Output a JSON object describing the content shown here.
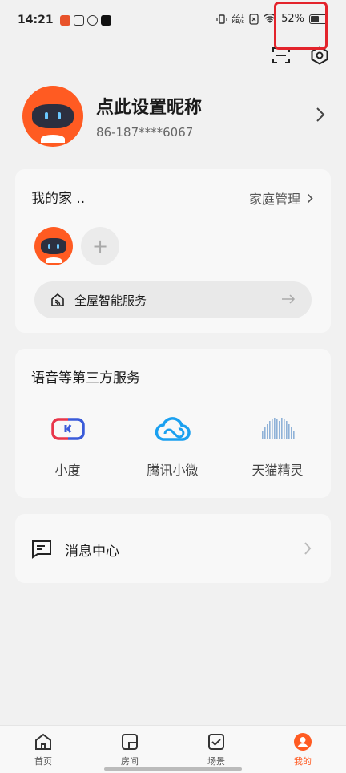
{
  "status_bar": {
    "time": "14:21",
    "net_speed_value": "22.1",
    "net_speed_unit": "KB/s",
    "battery": "52%",
    "battery_level": 0.52
  },
  "profile": {
    "nickname": "点此设置昵称",
    "phone": "86-187****6067"
  },
  "home_card": {
    "title": "我的家 ..",
    "manage_label": "家庭管理",
    "add_symbol": "+",
    "service_label": "全屋智能服务"
  },
  "third_party": {
    "title": "语音等第三方服务",
    "items": [
      {
        "label": "小度",
        "icon": "xiaodu-icon"
      },
      {
        "label": "腾讯小微",
        "icon": "tencent-xiaowei-icon"
      },
      {
        "label": "天猫精灵",
        "icon": "tmall-genie-icon"
      }
    ]
  },
  "message_center": {
    "label": "消息中心"
  },
  "tabbar": {
    "tabs": [
      {
        "label": "首页",
        "icon": "home-icon"
      },
      {
        "label": "房间",
        "icon": "room-icon"
      },
      {
        "label": "场景",
        "icon": "scene-icon"
      },
      {
        "label": "我的",
        "icon": "profile-icon"
      }
    ],
    "active_index": 3
  },
  "colors": {
    "accent": "#ff5b22",
    "highlight_box": "#e3232b",
    "xiaodu_red": "#e8364a",
    "xiaodu_blue": "#3a5bd9",
    "tencent_blue": "#1aa0f0",
    "tmall_blue": "#8fb2d8"
  }
}
